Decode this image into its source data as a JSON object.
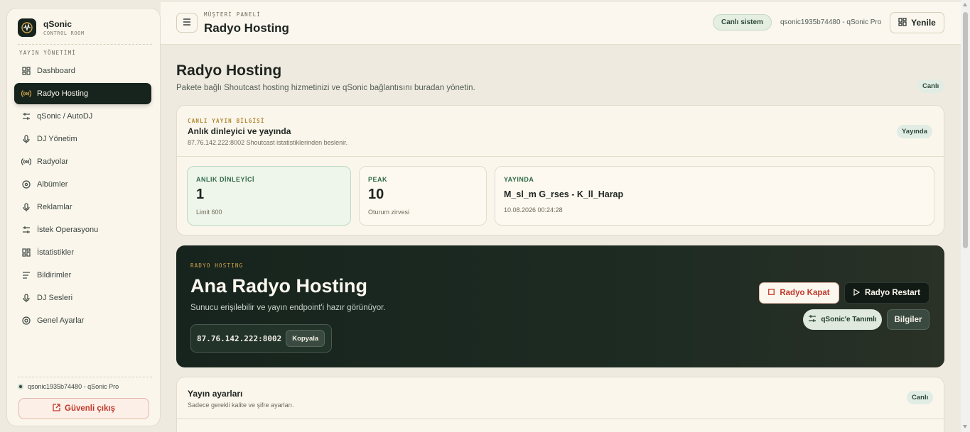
{
  "brand": {
    "name": "qSonic",
    "subtitle": "CONTROL ROOM"
  },
  "sidebar": {
    "section_label": "YAYIN YÖNETİMİ",
    "items": [
      {
        "label": "Dashboard",
        "icon": "grid-icon",
        "active": false
      },
      {
        "label": "Radyo Hosting",
        "icon": "broadcast-icon",
        "active": true
      },
      {
        "label": "qSonic / AutoDJ",
        "icon": "sliders-icon",
        "active": false
      },
      {
        "label": "DJ Yönetim",
        "icon": "microphone-icon",
        "active": false
      },
      {
        "label": "Radyolar",
        "icon": "broadcast-icon",
        "active": false
      },
      {
        "label": "Albümler",
        "icon": "disc-icon",
        "active": false
      },
      {
        "label": "Reklamlar",
        "icon": "microphone-icon",
        "active": false
      },
      {
        "label": "İstek Operasyonu",
        "icon": "sliders-icon",
        "active": false
      },
      {
        "label": "İstatistikler",
        "icon": "grid-icon",
        "active": false
      },
      {
        "label": "Bildirimler",
        "icon": "list-icon",
        "active": false
      },
      {
        "label": "DJ Sesleri",
        "icon": "microphone-icon",
        "active": false
      },
      {
        "label": "Genel Ayarlar",
        "icon": "gear-icon",
        "active": false
      }
    ],
    "user": "qsonic1935b74480 - qSonic Pro",
    "logout_label": "Güvenli çıkış"
  },
  "topbar": {
    "eyebrow": "MÜŞTERİ PANELİ",
    "title": "Radyo Hosting",
    "live_label": "Canlı sistem",
    "user": "qsonic1935b74480 - qSonic Pro",
    "refresh_label": "Yenile"
  },
  "page": {
    "title": "Radyo Hosting",
    "subtitle": "Pakete bağlı Shoutcast hosting hizmetinizi ve qSonic bağlantısını buradan yönetin.",
    "badge": "Canlı"
  },
  "live_card": {
    "eyebrow": "CANLI YAYIN BİLGİSİ",
    "title": "Anlık dinleyici ve yayında",
    "subtitle": "87.76.142.222:8002 Shoutcast istatistiklerinden beslenir.",
    "badge": "Yayında",
    "stats": [
      {
        "label": "ANLIK DİNLEYİCİ",
        "value": "1",
        "note": "Limit 600"
      },
      {
        "label": "PEAK",
        "value": "10",
        "note": "Oturum zirvesi"
      },
      {
        "label": "YAYINDA",
        "value": "M_sl_m G_rses - K_ll_Harap",
        "note": "10.08.2026 00:24:28"
      }
    ]
  },
  "hero": {
    "eyebrow": "RADYO HOSTING",
    "title": "Ana Radyo Hosting",
    "subtitle": "Sunucu erişilebilir ve yayın endpoint'i hazır görünüyor.",
    "endpoint": "87.76.142.222:8002",
    "copy_label": "Kopyala",
    "close_label": "Radyo Kapat",
    "restart_label": "Radyo Restart",
    "qsonic_label": "qSonic'e Tanımlı",
    "info_label": "Bilgiler"
  },
  "settings_card": {
    "title": "Yayın ayarları",
    "subtitle": "Sadece gerekli kalite ve şifre ayarları.",
    "badge": "Canlı"
  },
  "colors": {
    "accent_dark": "#17241d",
    "danger": "#c0392b",
    "gold": "#b0862f",
    "live_green": "#2f4a3a"
  }
}
